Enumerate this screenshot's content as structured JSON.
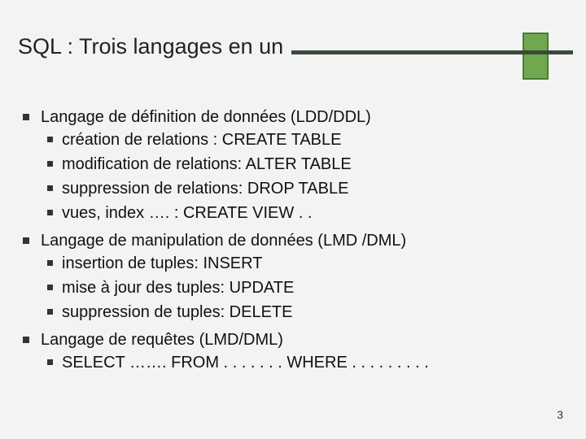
{
  "title": "SQL : Trois langages en un",
  "bullets": {
    "b0": {
      "text": "Langage de définition de données (LDD/DDL)",
      "s0": "création de relations : CREATE TABLE",
      "s1": "modification de relations: ALTER TABLE",
      "s2": "suppression de relations: DROP TABLE",
      "s3": "vues, index …. : CREATE VIEW . ."
    },
    "b1": {
      "text": "Langage de manipulation de données (LMD /DML)",
      "s0": "insertion de tuples: INSERT",
      "s1": "mise à jour des tuples: UPDATE",
      "s2": "suppression de tuples: DELETE"
    },
    "b2": {
      "text": "Langage de requêtes (LMD/DML)",
      "s0": "SELECT ……. FROM . . . . . . . WHERE . . . . . . . . ."
    }
  },
  "page_number": "3"
}
